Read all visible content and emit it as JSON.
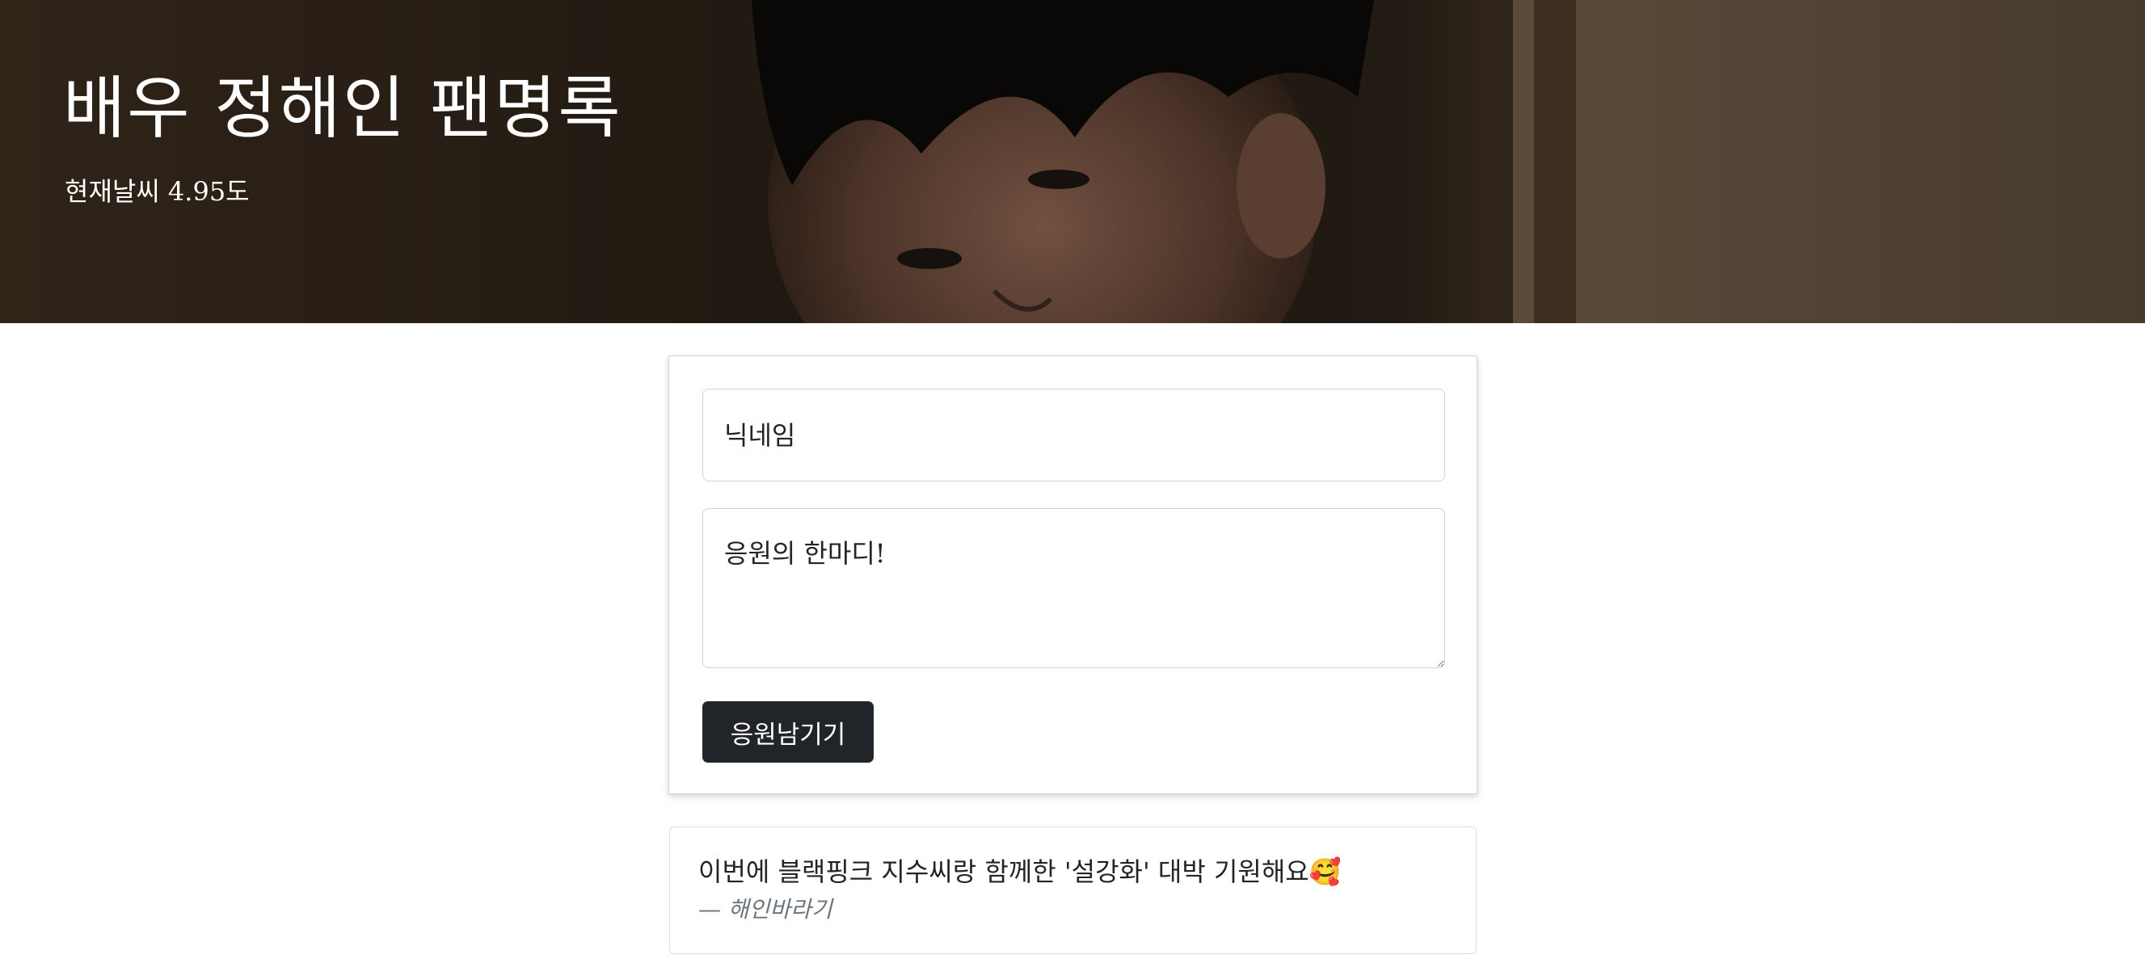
{
  "header": {
    "title": "배우 정해인 팬명록",
    "weather": "현재날씨 4.95도"
  },
  "form": {
    "nickname_placeholder": "닉네임",
    "message_placeholder": "응원의 한마디!",
    "submit_label": "응원남기기"
  },
  "comments": [
    {
      "text": "이번에 블랙핑크 지수씨랑 함께한 '설강화' 대박 기원해요🥰",
      "dash": "—",
      "author": "해인바라기"
    }
  ],
  "colors": {
    "button_bg": "#212529",
    "author_text": "#6c757d"
  }
}
